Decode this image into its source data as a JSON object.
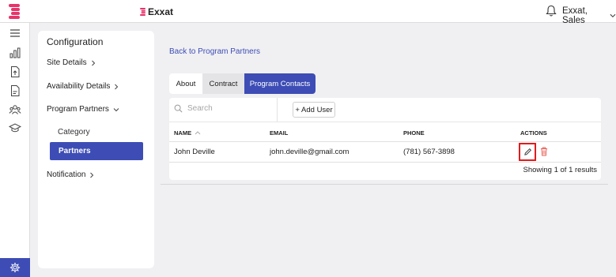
{
  "header": {
    "brand": "Exxat",
    "user": "Exxat, Sales"
  },
  "rail": {
    "icons": [
      "menu-icon",
      "bar-chart-icon",
      "document-upload-icon",
      "document-icon",
      "people-icon",
      "graduation-cap-icon",
      "settings-icon"
    ]
  },
  "config": {
    "title": "Configuration",
    "site_details": "Site Details",
    "availability_details": "Availability Details",
    "program_partners": "Program Partners",
    "category": "Category",
    "partners": "Partners",
    "notification": "Notification"
  },
  "main": {
    "back_link": "Back to Program Partners",
    "tabs": {
      "about": "About",
      "contract": "Contract",
      "program_contacts": "Program Contacts"
    },
    "search_placeholder": "Search",
    "add_user": "+ Add User",
    "columns": {
      "name": "NAME",
      "email": "EMAIL",
      "phone": "PHONE",
      "actions": "ACTIONS"
    },
    "rows": [
      {
        "name": "John Deville",
        "email": "john.deville@gmail.com",
        "phone": "(781) 567-3898"
      }
    ],
    "results": "Showing 1 of 1 results"
  },
  "colors": {
    "accent": "#3d4db5",
    "brand": "#e8336b",
    "delete": "#e8584e",
    "highlight": "#e01b1b"
  }
}
